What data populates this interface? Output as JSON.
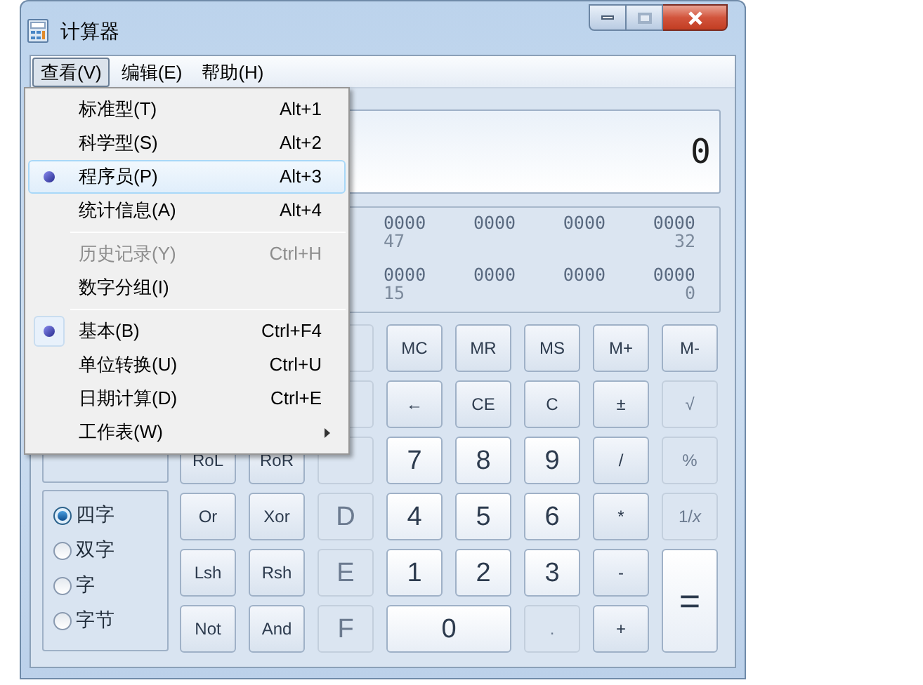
{
  "window": {
    "title": "计算器"
  },
  "menu_bar": [
    {
      "label": "查看(V)",
      "selected": true
    },
    {
      "label": "编辑(E)",
      "selected": false
    },
    {
      "label": "帮助(H)",
      "selected": false
    }
  ],
  "view_menu": [
    {
      "kind": "item",
      "label": "标准型(T)",
      "shortcut": "Alt+1",
      "checked": false,
      "highlighted": false,
      "disabled": false,
      "submenu": false
    },
    {
      "kind": "item",
      "label": "科学型(S)",
      "shortcut": "Alt+2",
      "checked": false,
      "highlighted": false,
      "disabled": false,
      "submenu": false
    },
    {
      "kind": "item",
      "label": "程序员(P)",
      "shortcut": "Alt+3",
      "checked": true,
      "highlighted": true,
      "disabled": false,
      "submenu": false
    },
    {
      "kind": "item",
      "label": "统计信息(A)",
      "shortcut": "Alt+4",
      "checked": false,
      "highlighted": false,
      "disabled": false,
      "submenu": false
    },
    {
      "kind": "separator"
    },
    {
      "kind": "item",
      "label": "历史记录(Y)",
      "shortcut": "Ctrl+H",
      "checked": false,
      "highlighted": false,
      "disabled": true,
      "submenu": false
    },
    {
      "kind": "item",
      "label": "数字分组(I)",
      "checked": false,
      "highlighted": false,
      "disabled": false,
      "submenu": false
    },
    {
      "kind": "separator"
    },
    {
      "kind": "item",
      "label": "基本(B)",
      "shortcut": "Ctrl+F4",
      "checked": true,
      "highlighted": false,
      "disabled": false,
      "submenu": false
    },
    {
      "kind": "item",
      "label": "单位转换(U)",
      "shortcut": "Ctrl+U",
      "checked": false,
      "highlighted": false,
      "disabled": false,
      "submenu": false
    },
    {
      "kind": "item",
      "label": "日期计算(D)",
      "shortcut": "Ctrl+E",
      "checked": false,
      "highlighted": false,
      "disabled": false,
      "submenu": false
    },
    {
      "kind": "item",
      "label": "工作表(W)",
      "checked": false,
      "highlighted": false,
      "disabled": false,
      "submenu": true
    }
  ],
  "display": {
    "value": "0"
  },
  "bit_display": [
    {
      "groups": [
        "0000",
        "0000",
        "0000",
        "0000"
      ],
      "labels": [
        "47",
        "32"
      ]
    },
    {
      "groups": [
        "0000",
        "0000",
        "0000",
        "0000"
      ],
      "labels": [
        "15",
        "0"
      ]
    }
  ],
  "word_size": [
    {
      "label": "四字",
      "selected": true
    },
    {
      "label": "双字",
      "selected": false
    },
    {
      "label": "字",
      "selected": false
    },
    {
      "label": "字节",
      "selected": false
    }
  ],
  "keys": [
    [
      {
        "kind": "hidden"
      },
      {
        "kind": "hidden"
      },
      {
        "kind": "function",
        "disabled": true
      },
      {
        "kind": "function",
        "label": "MC",
        "disabled": false
      },
      {
        "kind": "function",
        "label": "MR",
        "disabled": false
      },
      {
        "kind": "function",
        "label": "MS",
        "disabled": false
      },
      {
        "kind": "function",
        "label": "M+",
        "disabled": false
      },
      {
        "kind": "function",
        "label": "M-",
        "disabled": false
      }
    ],
    [
      {
        "kind": "hidden"
      },
      {
        "kind": "hidden"
      },
      {
        "kind": "function",
        "disabled": true
      },
      {
        "kind": "function",
        "label": "←",
        "disabled": false
      },
      {
        "kind": "function",
        "label": "CE",
        "disabled": false
      },
      {
        "kind": "function",
        "label": "C",
        "disabled": false
      },
      {
        "kind": "function",
        "label": "±",
        "disabled": false
      },
      {
        "kind": "function",
        "label": "√",
        "disabled": true
      }
    ],
    [
      {
        "kind": "function",
        "label": "RoL",
        "disabled": false
      },
      {
        "kind": "function",
        "label": "RoR",
        "disabled": false
      },
      {
        "kind": "digit",
        "disabled": true
      },
      {
        "kind": "digit",
        "label": "7",
        "disabled": false
      },
      {
        "kind": "digit",
        "label": "8",
        "disabled": false
      },
      {
        "kind": "digit",
        "label": "9",
        "disabled": false
      },
      {
        "kind": "function",
        "label": "/",
        "disabled": false
      },
      {
        "kind": "function",
        "label": "%",
        "disabled": true
      }
    ],
    [
      {
        "kind": "function",
        "label": "Or",
        "disabled": false
      },
      {
        "kind": "function",
        "label": "Xor",
        "disabled": false
      },
      {
        "kind": "digit",
        "label": "D",
        "disabled": true
      },
      {
        "kind": "digit",
        "label": "4",
        "disabled": false
      },
      {
        "kind": "digit",
        "label": "5",
        "disabled": false
      },
      {
        "kind": "digit",
        "label": "6",
        "disabled": false
      },
      {
        "kind": "function",
        "label": "*",
        "disabled": false
      },
      {
        "kind": "function",
        "label": "1/*x*",
        "disabled": true
      }
    ],
    [
      {
        "kind": "function",
        "label": "Lsh",
        "disabled": false
      },
      {
        "kind": "function",
        "label": "Rsh",
        "disabled": false
      },
      {
        "kind": "digit",
        "label": "E",
        "disabled": true
      },
      {
        "kind": "digit",
        "label": "1",
        "disabled": false
      },
      {
        "kind": "digit",
        "label": "2",
        "disabled": false
      },
      {
        "kind": "digit",
        "label": "3",
        "disabled": false
      },
      {
        "kind": "function",
        "label": "-",
        "disabled": false
      },
      {
        "kind": "tall",
        "label": "=",
        "disabled": false
      }
    ],
    [
      {
        "kind": "function",
        "label": "Not",
        "disabled": false
      },
      {
        "kind": "function",
        "label": "And",
        "disabled": false
      },
      {
        "kind": "digit",
        "label": "F",
        "disabled": true
      },
      {
        "kind": "wide",
        "label": "0",
        "disabled": false
      },
      {
        "kind": "function",
        "label": ".",
        "disabled": true
      },
      {
        "kind": "function",
        "label": "+",
        "disabled": false
      }
    ]
  ]
}
